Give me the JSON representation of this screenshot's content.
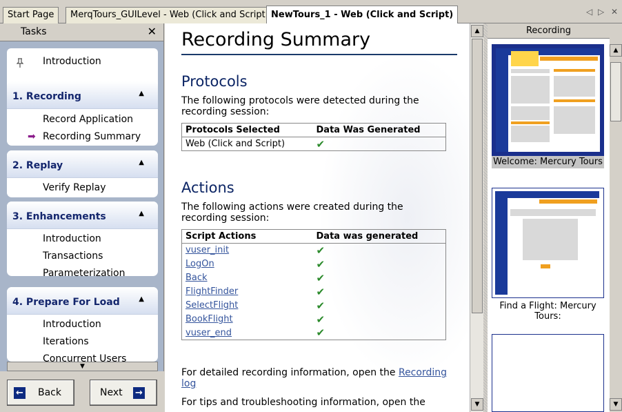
{
  "tabs": [
    {
      "label": "Start Page"
    },
    {
      "label": "MerqTours_GUILevel - Web (Click and Script)"
    },
    {
      "label": "NewTours_1 - Web (Click and Script)"
    }
  ],
  "tab_nav": {
    "prev": "◁",
    "next": "▷",
    "close": "✕"
  },
  "tasks": {
    "title": "Tasks",
    "close": "✕",
    "intro": "Introduction",
    "groups": [
      {
        "title": "1. Recording",
        "items": [
          "Record Application",
          "Recording Summary"
        ]
      },
      {
        "title": "2. Replay",
        "items": [
          "Verify Replay"
        ]
      },
      {
        "title": "3. Enhancements",
        "items": [
          "Introduction",
          "Transactions",
          "Parameterization"
        ]
      },
      {
        "title": "4. Prepare For Load",
        "items": [
          "Introduction",
          "Iterations",
          "Concurrent Users"
        ]
      }
    ],
    "back": "Back",
    "next": "Next"
  },
  "content": {
    "title": "Recording Summary",
    "protocols": {
      "heading": "Protocols",
      "text": "The following protocols were detected during the recording session:",
      "col1": "Protocols Selected",
      "col2": "Data Was Generated",
      "rows": [
        "Web (Click and Script)"
      ]
    },
    "actions": {
      "heading": "Actions",
      "text": "The following actions were created during the recording session:",
      "col1": "Script Actions",
      "col2": "Data was generated",
      "rows": [
        "vuser_init",
        "LogOn",
        "Back",
        "FlightFinder",
        "SelectFlight",
        "BookFlight",
        "vuser_end"
      ]
    },
    "footer1_pre": "For detailed recording information, open the ",
    "footer1_link": "Recording log",
    "footer2": "For tips and troubleshooting information, open the"
  },
  "recording": {
    "header": "Recording",
    "thumbs": [
      "Welcome: Mercury Tours",
      "Find a Flight: Mercury Tours:"
    ]
  },
  "colors": {
    "accent": "#1a2f8c",
    "heading": "#0b2464",
    "check": "#2b8a2b",
    "link": "#34549c"
  }
}
